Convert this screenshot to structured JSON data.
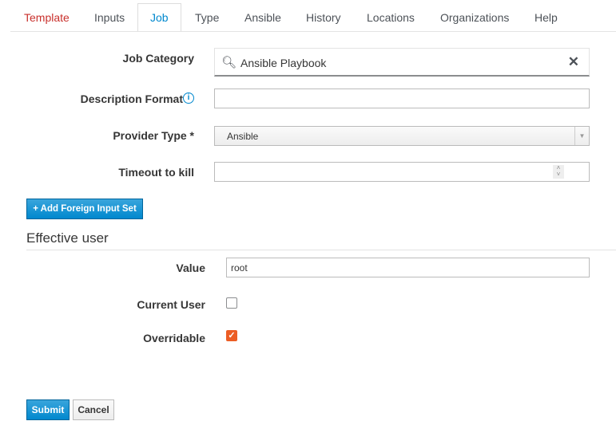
{
  "tabs": [
    "Template",
    "Inputs",
    "Job",
    "Type",
    "Ansible",
    "History",
    "Locations",
    "Organizations",
    "Help"
  ],
  "form": {
    "job_category_label": "Job Category",
    "job_category_value": "Ansible Playbook",
    "description_format_label": "Description Format",
    "provider_type_label": "Provider Type *",
    "provider_type_value": "Ansible",
    "timeout_label": "Timeout to kill",
    "add_foreign_label": "+ Add Foreign Input Set"
  },
  "effective_user": {
    "heading": "Effective user",
    "value_label": "Value",
    "value": "root",
    "current_user_label": "Current User",
    "current_user_checked": false,
    "overridable_label": "Overridable",
    "overridable_checked": true
  },
  "buttons": {
    "submit": "Submit",
    "cancel": "Cancel"
  },
  "colors": {
    "accent": "#0088ce",
    "checkbox": "#ec5d24",
    "template_tab": "#c9302c"
  }
}
